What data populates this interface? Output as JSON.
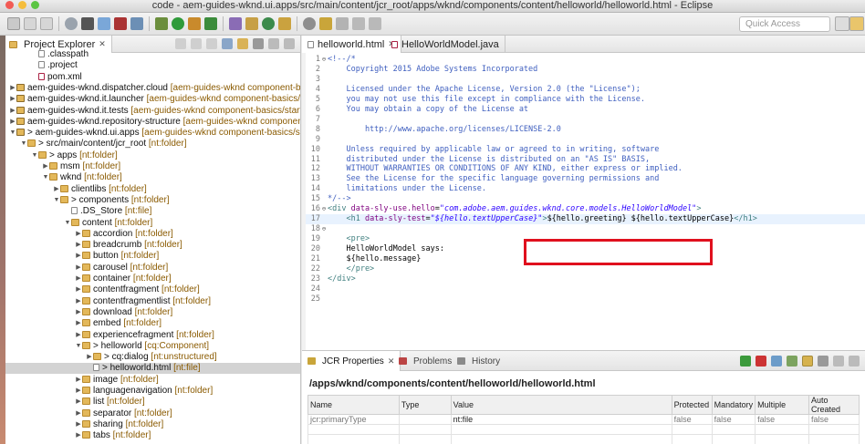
{
  "window": {
    "title": "code - aem-guides-wknd.ui.apps/src/main/content/jcr_root/apps/wknd/components/content/helloworld/helloworld.html - Eclipse",
    "traffic_lights": [
      "#f25b55",
      "#f5bd3c",
      "#5bc542"
    ]
  },
  "toolbar": {
    "quick_access_placeholder": "Quick Access"
  },
  "explorer": {
    "tab_label": "Project Explorer",
    "close_glyph": "✕",
    "rows": [
      {
        "indent": 2,
        "twisty": "",
        "icon": "file",
        "name": ".classpath",
        "ext": ""
      },
      {
        "indent": 2,
        "twisty": "",
        "icon": "file",
        "name": ".project",
        "ext": ""
      },
      {
        "indent": 2,
        "twisty": "",
        "icon": "xml",
        "name": "pom.xml",
        "ext": ""
      },
      {
        "indent": 0,
        "twisty": "▶",
        "icon": "project",
        "name": "aem-guides-wknd.dispatcher.cloud",
        "ext": " [aem-guides-wknd component-basics/st"
      },
      {
        "indent": 0,
        "twisty": "▶",
        "icon": "project",
        "name": "aem-guides-wknd.it.launcher",
        "ext": " [aem-guides-wknd component-basics/start]"
      },
      {
        "indent": 0,
        "twisty": "▶",
        "icon": "project",
        "name": "aem-guides-wknd.it.tests",
        "ext": " [aem-guides-wknd component-basics/start]"
      },
      {
        "indent": 0,
        "twisty": "▶",
        "icon": "project",
        "name": "aem-guides-wknd.repository-structure",
        "ext": " [aem-guides-wknd component-basic"
      },
      {
        "indent": 0,
        "twisty": "▼",
        "icon": "project",
        "name": "> aem-guides-wknd.ui.apps",
        "ext": " [aem-guides-wknd component-basics/start]"
      },
      {
        "indent": 1,
        "twisty": "▼",
        "icon": "folder",
        "name": "> src/main/content/jcr_root",
        "ext": " [nt:folder]"
      },
      {
        "indent": 2,
        "twisty": "▼",
        "icon": "folder",
        "name": "> apps",
        "ext": " [nt:folder]"
      },
      {
        "indent": 3,
        "twisty": "▶",
        "icon": "folder",
        "name": "msm",
        "ext": " [nt:folder]"
      },
      {
        "indent": 3,
        "twisty": "▼",
        "icon": "folder",
        "name": "wknd",
        "ext": " [nt:folder]"
      },
      {
        "indent": 4,
        "twisty": "▶",
        "icon": "folder",
        "name": "clientlibs",
        "ext": " [nt:folder]"
      },
      {
        "indent": 4,
        "twisty": "▼",
        "icon": "folder",
        "name": "> components",
        "ext": " [nt:folder]"
      },
      {
        "indent": 5,
        "twisty": "",
        "icon": "file",
        "name": ".DS_Store",
        "ext": " [nt:file]"
      },
      {
        "indent": 5,
        "twisty": "▼",
        "icon": "folder",
        "name": "content",
        "ext": " [nt:folder]"
      },
      {
        "indent": 6,
        "twisty": "▶",
        "icon": "folder",
        "name": "accordion",
        "ext": " [nt:folder]"
      },
      {
        "indent": 6,
        "twisty": "▶",
        "icon": "folder",
        "name": "breadcrumb",
        "ext": " [nt:folder]"
      },
      {
        "indent": 6,
        "twisty": "▶",
        "icon": "folder",
        "name": "button",
        "ext": " [nt:folder]"
      },
      {
        "indent": 6,
        "twisty": "▶",
        "icon": "folder",
        "name": "carousel",
        "ext": " [nt:folder]"
      },
      {
        "indent": 6,
        "twisty": "▶",
        "icon": "folder",
        "name": "container",
        "ext": " [nt:folder]"
      },
      {
        "indent": 6,
        "twisty": "▶",
        "icon": "folder",
        "name": "contentfragment",
        "ext": " [nt:folder]"
      },
      {
        "indent": 6,
        "twisty": "▶",
        "icon": "folder",
        "name": "contentfragmentlist",
        "ext": " [nt:folder]"
      },
      {
        "indent": 6,
        "twisty": "▶",
        "icon": "folder",
        "name": "download",
        "ext": " [nt:folder]"
      },
      {
        "indent": 6,
        "twisty": "▶",
        "icon": "folder",
        "name": "embed",
        "ext": " [nt:folder]"
      },
      {
        "indent": 6,
        "twisty": "▶",
        "icon": "folder",
        "name": "experiencefragment",
        "ext": " [nt:folder]"
      },
      {
        "indent": 6,
        "twisty": "▼",
        "icon": "folder",
        "name": "> helloworld",
        "ext": " [cq:Component]"
      },
      {
        "indent": 7,
        "twisty": "▶",
        "icon": "folder",
        "name": "> cq:dialog",
        "ext": " [nt:unstructured]"
      },
      {
        "indent": 7,
        "twisty": "",
        "icon": "file",
        "name": "> helloworld.html",
        "ext": " [nt:file]",
        "selected": true
      },
      {
        "indent": 6,
        "twisty": "▶",
        "icon": "folder",
        "name": "image",
        "ext": " [nt:folder]"
      },
      {
        "indent": 6,
        "twisty": "▶",
        "icon": "folder",
        "name": "languagenavigation",
        "ext": " [nt:folder]"
      },
      {
        "indent": 6,
        "twisty": "▶",
        "icon": "folder",
        "name": "list",
        "ext": " [nt:folder]"
      },
      {
        "indent": 6,
        "twisty": "▶",
        "icon": "folder",
        "name": "separator",
        "ext": " [nt:folder]"
      },
      {
        "indent": 6,
        "twisty": "▶",
        "icon": "folder",
        "name": "sharing",
        "ext": " [nt:folder]"
      },
      {
        "indent": 6,
        "twisty": "▶",
        "icon": "folder",
        "name": "tabs",
        "ext": " [nt:folder]"
      }
    ]
  },
  "editor": {
    "tabs": [
      {
        "label": "helloworld.html",
        "close": "✕",
        "active": true
      },
      {
        "label": "HelloWorldModel.java",
        "close": "",
        "active": false
      }
    ],
    "lines": [
      {
        "n": "1",
        "fold": "⊖",
        "segs": [
          [
            "cm",
            "<!--/*"
          ]
        ]
      },
      {
        "n": "2",
        "fold": "",
        "segs": [
          [
            "cm",
            "    Copyright 2015 Adobe Systems Incorporated"
          ]
        ]
      },
      {
        "n": "3",
        "fold": "",
        "segs": [
          [
            "cm",
            ""
          ]
        ]
      },
      {
        "n": "4",
        "fold": "",
        "segs": [
          [
            "cm",
            "    Licensed under the Apache License, Version 2.0 (the \"License\");"
          ]
        ]
      },
      {
        "n": "5",
        "fold": "",
        "segs": [
          [
            "cm",
            "    you may not use this file except in compliance with the License."
          ]
        ]
      },
      {
        "n": "6",
        "fold": "",
        "segs": [
          [
            "cm",
            "    You may obtain a copy of the License at"
          ]
        ]
      },
      {
        "n": "7",
        "fold": "",
        "segs": [
          [
            "cm",
            ""
          ]
        ]
      },
      {
        "n": "8",
        "fold": "",
        "segs": [
          [
            "cm",
            "        http://www.apache.org/licenses/LICENSE-2.0"
          ]
        ]
      },
      {
        "n": "9",
        "fold": "",
        "segs": [
          [
            "cm",
            ""
          ]
        ]
      },
      {
        "n": "10",
        "fold": "",
        "segs": [
          [
            "cm",
            "    Unless required by applicable law or agreed to in writing, software"
          ]
        ]
      },
      {
        "n": "11",
        "fold": "",
        "segs": [
          [
            "cm",
            "    distributed under the License is distributed on an \"AS IS\" BASIS,"
          ]
        ]
      },
      {
        "n": "12",
        "fold": "",
        "segs": [
          [
            "cm",
            "    WITHOUT WARRANTIES OR CONDITIONS OF ANY KIND, either express or implied."
          ]
        ]
      },
      {
        "n": "13",
        "fold": "",
        "segs": [
          [
            "cm",
            "    See the License for the specific language governing permissions and"
          ]
        ]
      },
      {
        "n": "14",
        "fold": "",
        "segs": [
          [
            "cm",
            "    limitations under the License."
          ]
        ]
      },
      {
        "n": "15",
        "fold": "",
        "segs": [
          [
            "cm",
            "*/-->"
          ]
        ]
      },
      {
        "n": "16",
        "fold": "⊖",
        "segs": [
          [
            "tag",
            "<div "
          ],
          [
            "attr",
            "data-sly-use.hello"
          ],
          [
            "txt",
            "="
          ],
          [
            "val",
            "\"com.adobe.aem.guides.wknd.core.models.HelloWorldModel\""
          ],
          [
            "tag",
            ">"
          ]
        ]
      },
      {
        "n": "17",
        "fold": "",
        "current": true,
        "segs": [
          [
            "tag",
            "    <h1 "
          ],
          [
            "attr",
            "data-sly-test"
          ],
          [
            "txt",
            "="
          ],
          [
            "val",
            "\"${hello.textUpperCase}\""
          ],
          [
            "tag",
            ">"
          ],
          [
            "txt",
            "${hello.greeting} ${hello.textUpperCase}"
          ],
          [
            "tag",
            "</h1>"
          ]
        ]
      },
      {
        "n": "18",
        "fold": "⊖",
        "segs": [
          [
            "txt",
            ""
          ]
        ]
      },
      {
        "n": "19",
        "fold": "",
        "segs": [
          [
            "tag",
            "    <pre>"
          ]
        ]
      },
      {
        "n": "20",
        "fold": "",
        "segs": [
          [
            "txt",
            "    HelloWorldModel says:"
          ]
        ]
      },
      {
        "n": "21",
        "fold": "",
        "segs": [
          [
            "txt",
            "    ${hello.message}"
          ]
        ]
      },
      {
        "n": "22",
        "fold": "",
        "segs": [
          [
            "tag",
            "    </pre>"
          ]
        ]
      },
      {
        "n": "23",
        "fold": "",
        "segs": [
          [
            "tag",
            "</div>"
          ]
        ]
      },
      {
        "n": "24",
        "fold": "",
        "segs": [
          [
            "txt",
            ""
          ]
        ]
      },
      {
        "n": "25",
        "fold": "",
        "segs": [
          [
            "txt",
            ""
          ]
        ]
      }
    ]
  },
  "bottom": {
    "tabs": [
      {
        "label": "JCR Properties",
        "close": "✕",
        "active": true
      },
      {
        "label": "Problems",
        "close": "",
        "active": false
      },
      {
        "label": "History",
        "close": "",
        "active": false
      }
    ],
    "path": "/apps/wknd/components/content/helloworld/helloworld.html",
    "columns": [
      "Name",
      "Type",
      "Value",
      "Protected",
      "Mandatory",
      "Multiple",
      "Auto Created"
    ],
    "rows": [
      [
        "jcr:primaryType",
        "",
        "nt:file",
        "false",
        "false",
        "false",
        "false"
      ]
    ]
  }
}
